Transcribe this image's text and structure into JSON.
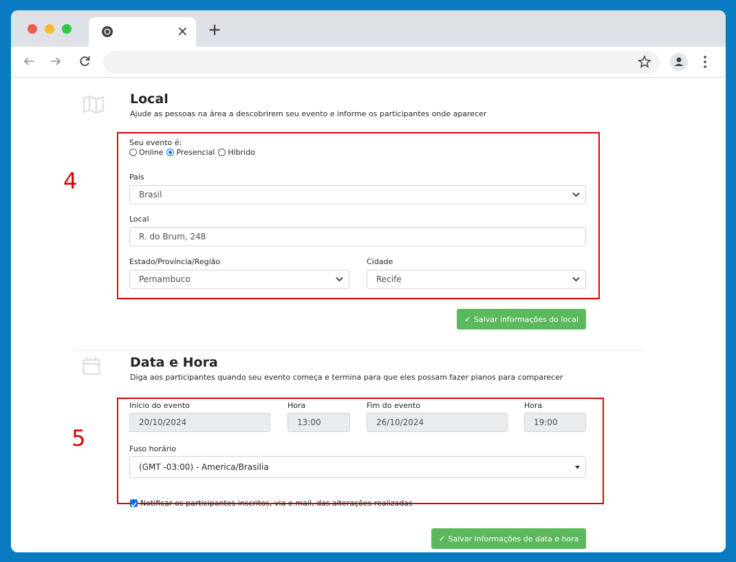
{
  "browser": {
    "tab_close": "×",
    "new_tab": "+"
  },
  "local": {
    "title": "Local",
    "description": "Ajude as pessoas na área a descobrirem seu evento e informe os participantes onde aparecer",
    "step_number": "4",
    "event_type_label": "Seu evento é:",
    "event_type_options": [
      "Online",
      "Presencial",
      "Híbrido"
    ],
    "event_type_selected": "Presencial",
    "country_label": "País",
    "country_value": "Brasil",
    "address_label": "Local",
    "address_value": "R. do Brum, 248",
    "state_label": "Estado/Província/Região",
    "state_value": "Pernambuco",
    "city_label": "Cidade",
    "city_value": "Recife",
    "save_button": "Salvar informações do local"
  },
  "datetime": {
    "title": "Data e Hora",
    "description": "Diga aos participantes quando seu evento começa e termina para que eles possam fazer planos para comparecer",
    "step_number": "5",
    "start_label": "Início do evento",
    "start_value": "20/10/2024",
    "start_time_label": "Hora",
    "start_time_value": "13:00",
    "end_label": "Fim do evento",
    "end_value": "26/10/2024",
    "end_time_label": "Hora",
    "end_time_value": "19:00",
    "timezone_label": "Fuso horário",
    "timezone_value": "(GMT -03:00) - America/Brasilia",
    "notify_label": "Notificar os participantes inscritos, via e-mail, das alterações realizadas",
    "notify_checked": true,
    "save_button": "Salvar informações de data e hora"
  },
  "colors": {
    "background": "#0a7bc2",
    "highlight": "#e00000",
    "button": "#5cb85c",
    "accent": "#0b6fde"
  }
}
